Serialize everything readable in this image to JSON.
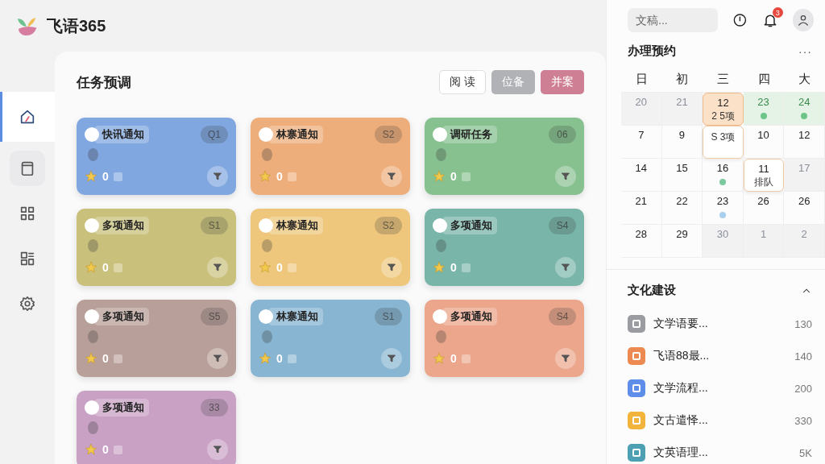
{
  "app": {
    "title": "飞语365"
  },
  "sidebar": {
    "items": [
      {
        "selected": true
      },
      {
        "selected": false
      },
      {
        "selected": false
      },
      {
        "selected": false
      },
      {
        "selected": false
      }
    ]
  },
  "main": {
    "title": "任务预调",
    "actions": [
      {
        "label": "阅 读",
        "kind": "outline"
      },
      {
        "label": "位备",
        "kind": "grey"
      },
      {
        "label": "并案",
        "kind": "pink"
      }
    ],
    "cards": [
      {
        "title": "快讯通知",
        "badge": "Q1",
        "stars": "0",
        "color": "#80a7e0"
      },
      {
        "title": "林寨通知",
        "badge": "S2",
        "stars": "0",
        "color": "#eeae7b"
      },
      {
        "title": "调研任务",
        "badge": "06",
        "stars": "0",
        "color": "#87c190"
      },
      {
        "title": "多项通知",
        "badge": "S1",
        "stars": "0",
        "color": "#c9c07b"
      },
      {
        "title": "林寨通知",
        "badge": "S2",
        "stars": "0",
        "color": "#eec77c"
      },
      {
        "title": "多项通知",
        "badge": "S4",
        "stars": "0",
        "color": "#79b6a9"
      },
      {
        "title": "多项通知",
        "badge": "S5",
        "stars": "0",
        "color": "#b99f99"
      },
      {
        "title": "林寨通知",
        "badge": "S1",
        "stars": "0",
        "color": "#87b5d2"
      },
      {
        "title": "多项通知",
        "badge": "S4",
        "stars": "0",
        "color": "#eba68b"
      },
      {
        "title": "多项通知",
        "badge": "33",
        "stars": "0",
        "color": "#c9a1c5"
      }
    ]
  },
  "topbar": {
    "search": {
      "placeholder": "文稿..."
    },
    "notifications": "3"
  },
  "calendar": {
    "title": "办理预约",
    "more": "···",
    "weekdays": [
      "日",
      "初",
      "三",
      "四",
      "大"
    ],
    "cells": [
      {
        "day": "20",
        "kind": "muted"
      },
      {
        "day": "21",
        "kind": "muted"
      },
      {
        "day": "12",
        "kind": "today",
        "event": "2 5项"
      },
      {
        "day": "23",
        "kind": "green",
        "color": "#6cc489"
      },
      {
        "day": "24",
        "kind": "green",
        "color": "#6cc489"
      },
      {
        "day": "7",
        "kind": "plain"
      },
      {
        "day": "9",
        "kind": "plain"
      },
      {
        "kind": "event",
        "event": "S 3项"
      },
      {
        "day": "10",
        "kind": "plain"
      },
      {
        "day": "12",
        "kind": "plain"
      },
      {
        "day": "14",
        "kind": "plain"
      },
      {
        "day": "15",
        "kind": "plain"
      },
      {
        "day": "16",
        "kind": "plain",
        "color": "#7cc9a0"
      },
      {
        "day": "11",
        "kind": "event",
        "event": "排队"
      },
      {
        "day": "17",
        "kind": "muted"
      },
      {
        "day": "21",
        "kind": "plain"
      },
      {
        "day": "22",
        "kind": "plain"
      },
      {
        "day": "23",
        "kind": "plain",
        "color": "#a9cfee"
      },
      {
        "day": "26",
        "kind": "plain"
      },
      {
        "day": "26",
        "kind": "plain"
      },
      {
        "day": "28",
        "kind": "plain"
      },
      {
        "day": "29",
        "kind": "plain"
      },
      {
        "day": "30",
        "kind": "muted"
      },
      {
        "day": "1",
        "kind": "muted"
      },
      {
        "day": "2",
        "kind": "muted"
      }
    ]
  },
  "resources": {
    "title": "文化建设",
    "expanded": true,
    "items": [
      {
        "name": "文学语要...",
        "count": "130",
        "color": "#9a9ca2"
      },
      {
        "name": "飞语88最...",
        "count": "140",
        "color": "#ec8a52"
      },
      {
        "name": "文学流程...",
        "count": "200",
        "color": "#5e8eea"
      },
      {
        "name": "文古遣怿...",
        "count": "330",
        "color": "#f3b43c"
      },
      {
        "name": "文英语理...",
        "count": "5K",
        "color": "#4d9fb3"
      }
    ]
  }
}
